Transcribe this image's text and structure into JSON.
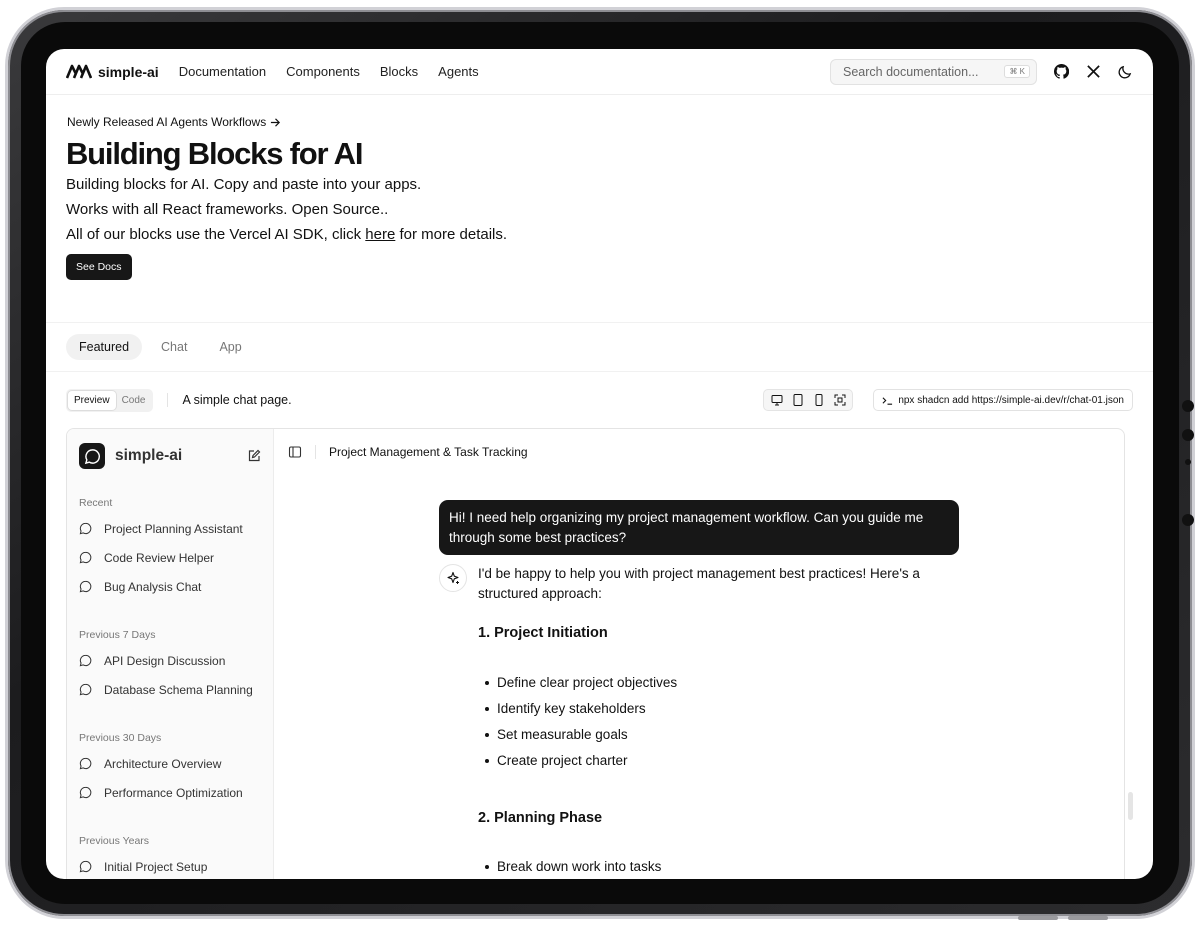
{
  "header": {
    "brand": "simple-ai",
    "nav": [
      "Documentation",
      "Components",
      "Blocks",
      "Agents"
    ],
    "search_placeholder": "Search documentation...",
    "search_shortcut": "⌘ K"
  },
  "hero": {
    "announcement": "Newly Released AI Agents Workflows",
    "title": "Building Blocks for AI",
    "line1": "Building blocks for AI. Copy and paste into your apps.",
    "line2": "Works with all React frameworks. Open Source..",
    "line3_before": "All of our blocks use the Vercel AI SDK, click ",
    "line3_link": "here",
    "line3_after": " for more details.",
    "cta": "See Docs"
  },
  "tabs": [
    "Featured",
    "Chat",
    "App"
  ],
  "preview_bar": {
    "preview_label": "Preview",
    "code_label": "Code",
    "description": "A simple chat page.",
    "command": "npx shadcn add https://simple-ai.dev/r/chat-01.json"
  },
  "sidebar": {
    "title": "simple-ai",
    "groups": [
      {
        "label": "Recent",
        "items": [
          "Project Planning Assistant",
          "Code Review Helper",
          "Bug Analysis Chat"
        ]
      },
      {
        "label": "Previous 7 Days",
        "items": [
          "API Design Discussion",
          "Database Schema Planning"
        ]
      },
      {
        "label": "Previous 30 Days",
        "items": [
          "Architecture Overview",
          "Performance Optimization"
        ]
      },
      {
        "label": "Previous Years",
        "items": [
          "Initial Project Setup"
        ]
      }
    ]
  },
  "chat": {
    "title": "Project Management & Task Tracking",
    "user_message": "Hi! I need help organizing my project management workflow. Can you guide me through some best practices?",
    "reply_intro": "I'd be happy to help you with project management best practices! Here's a structured approach:",
    "section1_title": "1. Project Initiation",
    "section1_items": [
      "Define clear project objectives",
      "Identify key stakeholders",
      "Set measurable goals",
      "Create project charter"
    ],
    "section2_title": "2. Planning Phase",
    "section2_items": [
      "Break down work into tasks"
    ]
  }
}
